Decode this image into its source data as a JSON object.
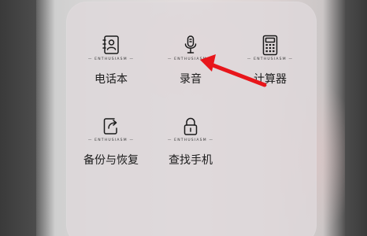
{
  "brand_text": "ENTHUSIASM",
  "tiles": [
    {
      "label": "电话本",
      "icon": "contacts-icon"
    },
    {
      "label": "录音",
      "icon": "microphone-icon"
    },
    {
      "label": "计算器",
      "icon": "calculator-icon"
    },
    {
      "label": "备份与恢复",
      "icon": "backup-restore-icon"
    },
    {
      "label": "查找手机",
      "icon": "lock-icon"
    }
  ],
  "colors": {
    "panel": "#ded8da",
    "icon_stroke": "#1a1a1a",
    "arrow": "#e8161b",
    "label": "#1c1c1c"
  }
}
